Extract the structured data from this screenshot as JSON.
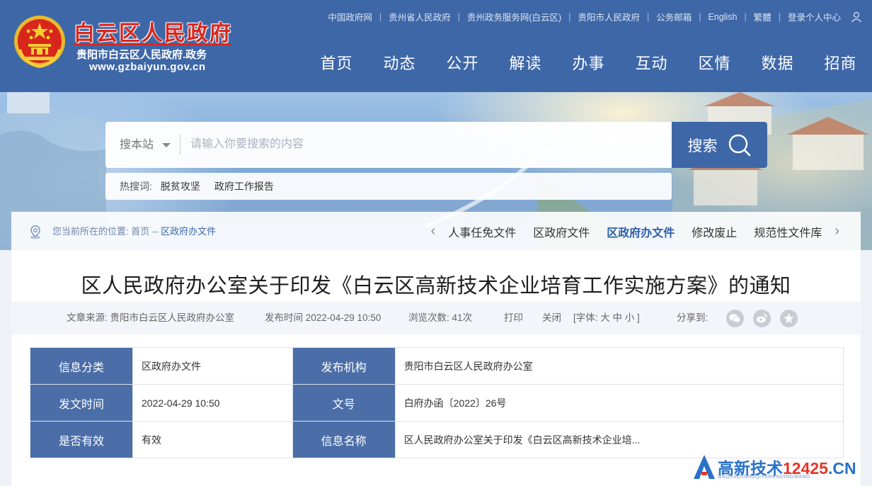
{
  "header": {
    "title": "白云区人民政府",
    "subtitle": "贵阳市白云区人民政府.政务",
    "url": "www.gzbaiyun.gov.cn",
    "toplinks": [
      "中国政府网",
      "贵州省人民政府",
      "贵州政务服务网(白云区)",
      "贵阳市人民政府",
      "公务邮箱",
      "English",
      "繁體",
      "登录个人中心"
    ],
    "nav": [
      "首页",
      "动态",
      "公开",
      "解读",
      "办事",
      "互动",
      "区情",
      "数据",
      "招商"
    ]
  },
  "search": {
    "scope": "搜本站",
    "placeholder": "请输入你要搜索的内容",
    "button": "搜索",
    "hot_label": "热搜词:",
    "hot_words": [
      "脱贫攻坚",
      "政府工作报告"
    ]
  },
  "breadcrumb": {
    "prefix": "您当前所在的位置: ",
    "home": "首页",
    "sep": " -- ",
    "current": "区政府办文件"
  },
  "subnav": [
    "人事任免文件",
    "区政府文件",
    "区政府办文件",
    "修改废止",
    "规范性文件库"
  ],
  "article": {
    "title": "区人民政府办公室关于印发《白云区高新技术企业培育工作实施方案》的通知",
    "meta": {
      "source": "文章来源:  贵阳市白云区人民政府办公室",
      "time": "发布时间 2022-04-29 10:50",
      "views": "浏览次数:  41次",
      "print": "打印",
      "close": "关闭",
      "font": "[字体: 大 中 小 ]",
      "share": "分享到:"
    },
    "info": [
      [
        "信息分类",
        "区政府办文件",
        "发布机构",
        "贵阳市白云区人民政府办公室"
      ],
      [
        "发文时间",
        "2022-04-29 10:50",
        "文号",
        "白府办函〔2022〕26号"
      ],
      [
        "是否有效",
        "有效",
        "信息名称",
        "区人民政府办公室关于印发《白云区高新技术企业培..."
      ]
    ]
  },
  "watermark": {
    "main": "高新技术",
    "num": "12425",
    "suffix": ".CN",
    "sub": "GAOXINJISHUQIYERENDINGWANG"
  },
  "colors": {
    "header": "#3e67a8",
    "title_red": "#d9261c",
    "table_key": "#4b6ea8"
  }
}
